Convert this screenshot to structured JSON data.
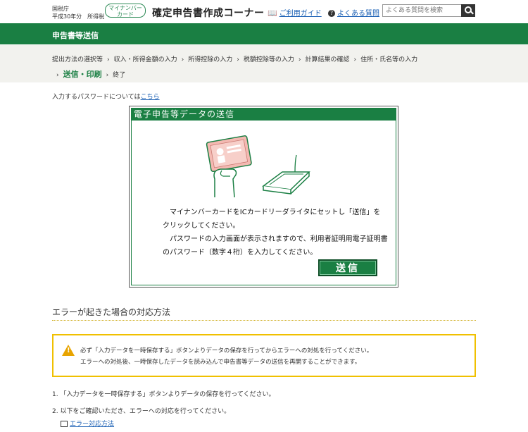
{
  "header": {
    "org_line1": "国税庁",
    "org_line2": "平成30年分　所得税",
    "badge_line1": "マイナンバー",
    "badge_line2": "カード",
    "app_title": "確定申告書作成コーナー",
    "guide_link": "ご利用ガイド",
    "faq_link": "よくある質問",
    "search_placeholder": "よくある質問を検索"
  },
  "section_title": "申告書等送信",
  "breadcrumb": {
    "row1": [
      "提出方法の選択等",
      "収入・所得金額の入力",
      "所得控除の入力",
      "税額控除等の入力",
      "計算結果の確認",
      "住所・氏名等の入力"
    ],
    "current": "送信・印刷",
    "last": "終了"
  },
  "password_note": {
    "text": "入力するパスワードについては",
    "link": "こちら"
  },
  "panel": {
    "title": "電子申告等データの送信",
    "msg1": "　マイナンバーカードをICカードリーダライタにセットし「送信」を",
    "msg2": "クリックしてください。",
    "msg3": "　パスワードの入力画面が表示されますので、利用者証明用電子証明書",
    "msg4": "のパスワード（数字４桁）を入力してください。",
    "send_button": "送信"
  },
  "error_section": {
    "heading": "エラーが起きた場合の対応方法",
    "warn_line1": "必ず「入力データを一時保存する」ボタンよりデータの保存を行ってからエラーへの対処を行ってください。",
    "warn_line2": "エラーへの対処後、一時保存したデータを読み込んで申告書等データの送信を再開することができます。",
    "step1": "1.  「入力データを一時保存する」ボタンよりデータの保存を行ってください。",
    "step2": "2.  以下をご確認いただき、エラーへの対応を行ってください。",
    "link": "エラー対応方法"
  }
}
